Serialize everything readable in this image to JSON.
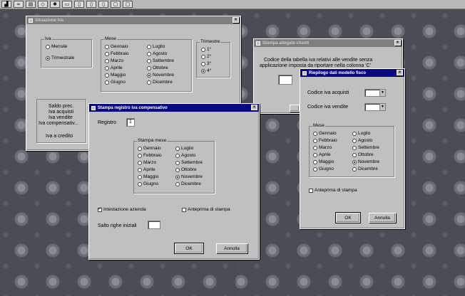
{
  "toolbar": {
    "icons": [
      "chart-icon",
      "glasses-icon",
      "document-icon",
      "cube-icon",
      "tools-icon",
      "printer-icon",
      "page-icon",
      "page-icon",
      "page-icon",
      "window-icon",
      "window-icon"
    ]
  },
  "win1": {
    "title": "Situazione Iva",
    "iva_group": "Iva",
    "iva_options": [
      "Mensile",
      "Trimestrale"
    ],
    "iva_selected": 1,
    "mese_group": "Mese",
    "months_col1": [
      "Gennaio",
      "Febbraio",
      "Marzo",
      "Aprile",
      "Maggio",
      "Giugno"
    ],
    "months_col2": [
      "Luglio",
      "Agosto",
      "Settembre",
      "Ottobre",
      "Novembre",
      "Dicembre"
    ],
    "trimestre_group": "Trimestre",
    "trimestri": [
      "1°",
      "2°",
      "3°",
      "4°"
    ],
    "trimestre_selected": 3,
    "labels": [
      "Saldo prec.",
      "Iva acquisti",
      "Iva vendite",
      "Iva compensativ...",
      "Iva a credito"
    ]
  },
  "win2": {
    "title": "Stampa allegato clienti",
    "text_line1": "Codice della tabella iva relativi alle vendite senza",
    "text_line2": "applicazione imposta da riportare nella colonna 'C'"
  },
  "win3": {
    "title": "Stampa registro iva compensativo",
    "registro_label": "Registro",
    "registro_value": "1",
    "group": "Stampa mese",
    "months_col1": [
      "Gennaio",
      "Febbraio",
      "Marzo",
      "Aprile",
      "Maggio",
      "Giugno"
    ],
    "months_col2": [
      "Luglio",
      "Agosto",
      "Settembre",
      "Ottobre",
      "Novembre",
      "Dicembre"
    ],
    "selected_month": "Novembre",
    "intestazione": "Intestazione azienda",
    "intestazione_checked": true,
    "anteprima": "Anteprima di stampa",
    "salta_label": "Salto righe iniziali",
    "ok": "OK",
    "annulla": "Annulla"
  },
  "win4": {
    "title": "Riepilogo dati modello fisco",
    "acquisti_label": "Codice iva acquisti",
    "vendite_label": "Codice iva vendite",
    "group": "Mese",
    "months_col1": [
      "Gennaio",
      "Febbraio",
      "Marzo",
      "Aprile",
      "Maggio",
      "Giugno"
    ],
    "months_col2": [
      "Luglio",
      "Agosto",
      "Settembre",
      "Ottobre",
      "Novembre",
      "Dicembre"
    ],
    "selected_month": "Novembre",
    "anteprima": "Anteprima di stampa",
    "ok": "OK",
    "annulla": "Annulla"
  }
}
